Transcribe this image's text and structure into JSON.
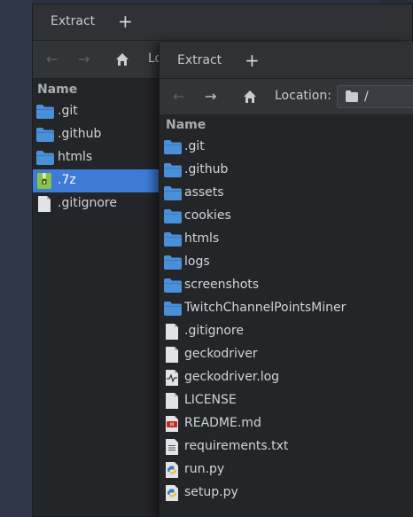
{
  "back_window": {
    "title": "Extract",
    "new_tab": "+",
    "column_header": "Name",
    "location_stub": "Lo",
    "files": [
      {
        "name": ".git",
        "icon": "folder-icon"
      },
      {
        "name": ".github",
        "icon": "folder-icon"
      },
      {
        "name": "htmls",
        "icon": "folder-icon"
      },
      {
        "name": ".7z",
        "icon": "archive-icon",
        "selected": true
      },
      {
        "name": ".gitignore",
        "icon": "text-file-icon"
      }
    ]
  },
  "front_window": {
    "title": "Extract",
    "new_tab": "+",
    "location_label": "Location:",
    "location_value": "/",
    "column_header": "Name",
    "files": [
      {
        "name": ".git",
        "icon": "folder-icon"
      },
      {
        "name": ".github",
        "icon": "folder-icon"
      },
      {
        "name": "assets",
        "icon": "folder-icon"
      },
      {
        "name": "cookies",
        "icon": "folder-icon"
      },
      {
        "name": "htmls",
        "icon": "folder-icon"
      },
      {
        "name": "logs",
        "icon": "folder-icon"
      },
      {
        "name": "screenshots",
        "icon": "folder-icon"
      },
      {
        "name": "TwitchChannelPointsMiner",
        "icon": "folder-icon"
      },
      {
        "name": ".gitignore",
        "icon": "text-file-icon"
      },
      {
        "name": "geckodriver",
        "icon": "binary-file-icon"
      },
      {
        "name": "geckodriver.log",
        "icon": "log-file-icon"
      },
      {
        "name": "LICENSE",
        "icon": "text-file-icon"
      },
      {
        "name": "README.md",
        "icon": "markdown-file-icon"
      },
      {
        "name": "requirements.txt",
        "icon": "text-lines-file-icon"
      },
      {
        "name": "run.py",
        "icon": "python-file-icon"
      },
      {
        "name": "setup.py",
        "icon": "python-file-icon"
      }
    ]
  },
  "colors": {
    "folder": "#4a90d9",
    "selection": "#3e7bd6",
    "list_background": "#242528",
    "window_background": "#2d2f33"
  }
}
